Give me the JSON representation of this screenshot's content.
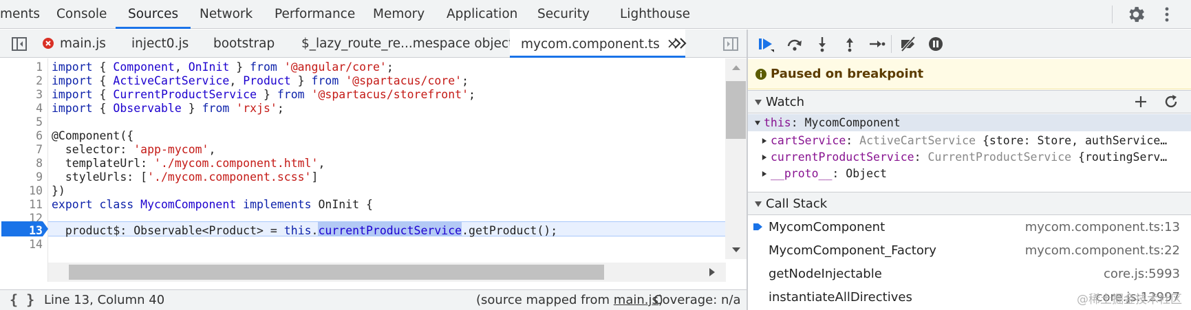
{
  "top_tabs": [
    {
      "label": "ments",
      "active": false
    },
    {
      "label": "Console",
      "active": false
    },
    {
      "label": "Sources",
      "active": true
    },
    {
      "label": "Network",
      "active": false
    },
    {
      "label": "Performance",
      "active": false
    },
    {
      "label": "Memory",
      "active": false
    },
    {
      "label": "Application",
      "active": false
    },
    {
      "label": "Security",
      "active": false
    },
    {
      "label": "Lighthouse",
      "active": false
    }
  ],
  "editor_tabs": [
    {
      "label": "main.js",
      "error": true
    },
    {
      "label": "inject0.js"
    },
    {
      "label": "bootstrap"
    },
    {
      "label": "$_lazy_route_re...mespace object"
    },
    {
      "label": "mycom.component.ts",
      "active": true,
      "close": "×"
    }
  ],
  "code": {
    "line_numbers": [
      "1",
      "2",
      "3",
      "4",
      "5",
      "6",
      "7",
      "8",
      "9",
      "10",
      "11",
      "12",
      "13",
      "14"
    ],
    "lines": [
      [
        [
          "kw",
          "import"
        ],
        [
          "",
          " { "
        ],
        [
          "id",
          "Component"
        ],
        [
          "",
          ", "
        ],
        [
          "id",
          "OnInit"
        ],
        [
          "",
          " } "
        ],
        [
          "kw",
          "from"
        ],
        [
          "",
          " "
        ],
        [
          "str",
          "'@angular/core'"
        ],
        [
          "",
          ";"
        ]
      ],
      [
        [
          "kw",
          "import"
        ],
        [
          "",
          " { "
        ],
        [
          "id",
          "ActiveCartService"
        ],
        [
          "",
          ", "
        ],
        [
          "id",
          "Product"
        ],
        [
          "",
          " } "
        ],
        [
          "kw",
          "from"
        ],
        [
          "",
          " "
        ],
        [
          "str",
          "'@spartacus/core'"
        ],
        [
          "",
          ";"
        ]
      ],
      [
        [
          "kw",
          "import"
        ],
        [
          "",
          " { "
        ],
        [
          "id",
          "CurrentProductService"
        ],
        [
          "",
          " } "
        ],
        [
          "kw",
          "from"
        ],
        [
          "",
          " "
        ],
        [
          "str",
          "'@spartacus/storefront'"
        ],
        [
          "",
          ";"
        ]
      ],
      [
        [
          "kw",
          "import"
        ],
        [
          "",
          " { "
        ],
        [
          "id",
          "Observable"
        ],
        [
          "",
          " } "
        ],
        [
          "kw",
          "from"
        ],
        [
          "",
          " "
        ],
        [
          "str",
          "'rxjs'"
        ],
        [
          "",
          ";"
        ]
      ],
      [],
      [
        [
          "",
          "@Component({"
        ]
      ],
      [
        [
          "",
          "  selector: "
        ],
        [
          "str",
          "'app-mycom'"
        ],
        [
          "",
          ","
        ]
      ],
      [
        [
          "",
          "  templateUrl: "
        ],
        [
          "str",
          "'./mycom.component.html'"
        ],
        [
          "",
          ","
        ]
      ],
      [
        [
          "",
          "  styleUrls: ["
        ],
        [
          "str",
          "'./mycom.component.scss'"
        ],
        [
          "",
          "]"
        ]
      ],
      [
        [
          "",
          "})"
        ]
      ],
      [
        [
          "kw",
          "export"
        ],
        [
          "",
          " "
        ],
        [
          "kw",
          "class"
        ],
        [
          "",
          " "
        ],
        [
          "id",
          "MycomComponent"
        ],
        [
          "",
          " "
        ],
        [
          "kw",
          "implements"
        ],
        [
          "",
          " OnInit {"
        ]
      ],
      [],
      [
        [
          "",
          "  product$: Observable<Product> = "
        ],
        [
          "kw",
          "this"
        ],
        [
          "",
          "."
        ],
        [
          "sel",
          "currentProductService"
        ],
        [
          "",
          ".getProduct();"
        ]
      ],
      []
    ],
    "current_line": "13"
  },
  "status": {
    "pretty_print": "{ }",
    "cursor": "Line 13, Column 40",
    "source_map_prefix": "(source mapped from ",
    "source_map_file": "main.js",
    "source_map_suffix": ")",
    "coverage": "Coverage: n/a"
  },
  "debugger": {
    "paused_message": "Paused on breakpoint",
    "watch_title": "Watch",
    "watch_rows": [
      {
        "indent": 0,
        "expanded": true,
        "name": "this",
        "sep": ": ",
        "value": "MycomComponent",
        "type": ""
      },
      {
        "indent": 1,
        "expanded": false,
        "name": "cartService",
        "sep": ": ",
        "value": "",
        "type": "ActiveCartService",
        "extra": " {store: Store, authService…"
      },
      {
        "indent": 1,
        "expanded": false,
        "name": "currentProductService",
        "sep": ": ",
        "value": "",
        "type": "CurrentProductService",
        "extra": " {routingServ…"
      },
      {
        "indent": 1,
        "expanded": false,
        "name": "__proto__",
        "sep": ": ",
        "value": "Object",
        "type": ""
      }
    ],
    "callstack_title": "Call Stack",
    "callstack": [
      {
        "fn": "MycomComponent",
        "loc": "mycom.component.ts:13",
        "current": true
      },
      {
        "fn": "MycomComponent_Factory",
        "loc": "mycom.component.ts:22"
      },
      {
        "fn": "getNodeInjectable",
        "loc": "core.js:5993"
      },
      {
        "fn": "instantiateAllDirectives",
        "loc": "core.js:12997"
      }
    ]
  },
  "watermark": "@稀土掘金技术社区",
  "colors": {
    "accent": "#1a73e8",
    "paused_bg": "#fffbe5",
    "exec_line": "#e8f0fe"
  }
}
